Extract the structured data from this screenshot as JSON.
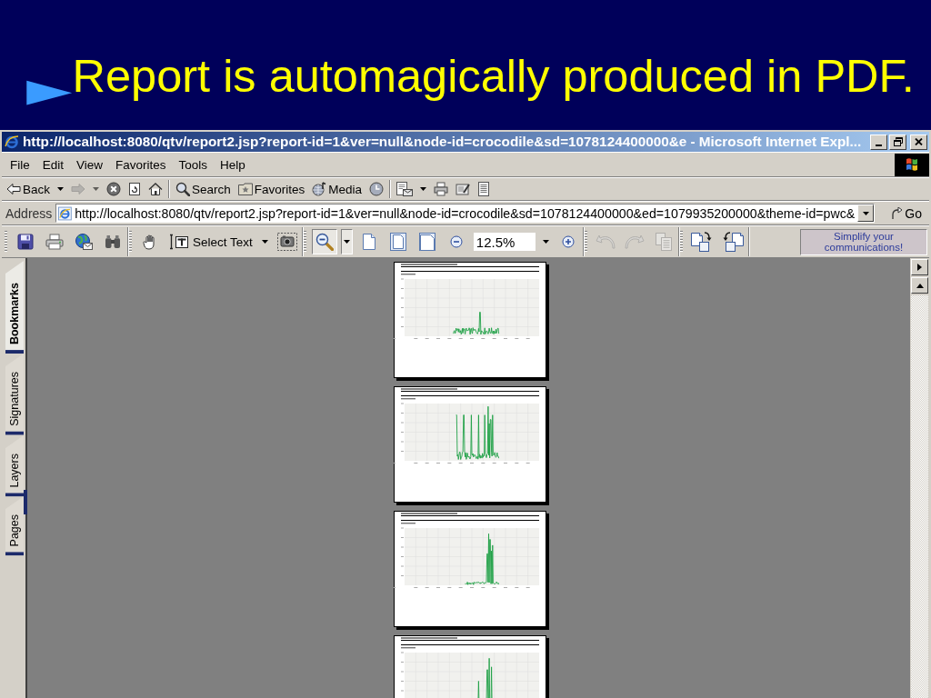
{
  "slide": {
    "bullet": "►",
    "title": "Report is automagically produced in PDF."
  },
  "window": {
    "title": "http://localhost:8080/qtv/report2.jsp?report-id=1&ver=null&node-id=crocodile&sd=1078124400000&e - Microsoft Internet Expl..."
  },
  "menu": [
    "File",
    "Edit",
    "View",
    "Favorites",
    "Tools",
    "Help"
  ],
  "browser_toolbar": [
    [
      {
        "kind": "back",
        "label": "Back",
        "disabled": false
      },
      {
        "kind": "dropdown",
        "disabled": false
      },
      {
        "kind": "forward",
        "disabled": true
      },
      {
        "kind": "dropdown",
        "disabled": true
      },
      {
        "kind": "stop",
        "disabled": false
      },
      {
        "kind": "refresh",
        "disabled": false
      },
      {
        "kind": "home",
        "disabled": false
      }
    ],
    [
      {
        "kind": "search",
        "label": "Search",
        "disabled": false
      },
      {
        "kind": "favorites",
        "label": "Favorites",
        "disabled": false
      },
      {
        "kind": "media",
        "label": "Media",
        "disabled": false
      },
      {
        "kind": "history",
        "disabled": false
      }
    ],
    [
      {
        "kind": "mail",
        "disabled": false
      },
      {
        "kind": "dropdown",
        "disabled": false
      },
      {
        "kind": "print",
        "disabled": false
      },
      {
        "kind": "edit",
        "disabled": false
      },
      {
        "kind": "discuss",
        "disabled": false
      }
    ]
  ],
  "address_bar": {
    "label": "Address",
    "value": "http://localhost:8080/qtv/report2.jsp?report-id=1&ver=null&node-id=crocodile&sd=1078124400000&ed=1079935200000&theme-id=pwc&",
    "go": "Go"
  },
  "reader_toolbar": {
    "groups": [
      [
        {
          "kind": "save",
          "selected": false,
          "disabled": false
        },
        {
          "kind": "print",
          "selected": false,
          "disabled": false
        },
        {
          "kind": "email",
          "selected": false,
          "disabled": false
        },
        {
          "kind": "find",
          "selected": false,
          "disabled": false
        }
      ],
      [
        {
          "kind": "hand_tool",
          "selected": false,
          "disabled": false
        },
        {
          "kind": "select_text",
          "label": "Select Text",
          "selected": false,
          "disabled": false
        },
        {
          "kind": "dropdown",
          "selected": false,
          "disabled": false
        },
        {
          "kind": "snapshot",
          "selected": false,
          "disabled": false
        }
      ],
      [
        {
          "kind": "zoom_tool",
          "selected": true,
          "disabled": false
        },
        {
          "kind": "dropdown",
          "selected": true,
          "disabled": false
        },
        {
          "kind": "actual_size",
          "selected": false,
          "disabled": false
        },
        {
          "kind": "fit_page",
          "selected": false,
          "disabled": false
        },
        {
          "kind": "fit_width",
          "selected": false,
          "disabled": false
        },
        {
          "kind": "zoom_out",
          "selected": false,
          "disabled": false
        },
        {
          "kind": "zoom_field",
          "value": "12.5%",
          "selected": false,
          "disabled": false
        },
        {
          "kind": "dropdown",
          "selected": false,
          "disabled": false
        },
        {
          "kind": "zoom_in",
          "selected": false,
          "disabled": false
        }
      ],
      [
        {
          "kind": "undo",
          "selected": false,
          "disabled": true
        },
        {
          "kind": "redo",
          "selected": false,
          "disabled": true
        },
        {
          "kind": "copy",
          "selected": false,
          "disabled": true
        }
      ],
      [
        {
          "kind": "rotate_cw",
          "selected": false,
          "disabled": false
        },
        {
          "kind": "rotate_ccw",
          "selected": false,
          "disabled": false
        }
      ]
    ],
    "ad": "Simplify your communications!"
  },
  "side_tabs": [
    {
      "label": "Bookmarks",
      "selected": true
    },
    {
      "label": "Signatures",
      "selected": false
    },
    {
      "label": "Layers",
      "selected": false
    },
    {
      "label": "Pages",
      "selected": false
    }
  ]
}
